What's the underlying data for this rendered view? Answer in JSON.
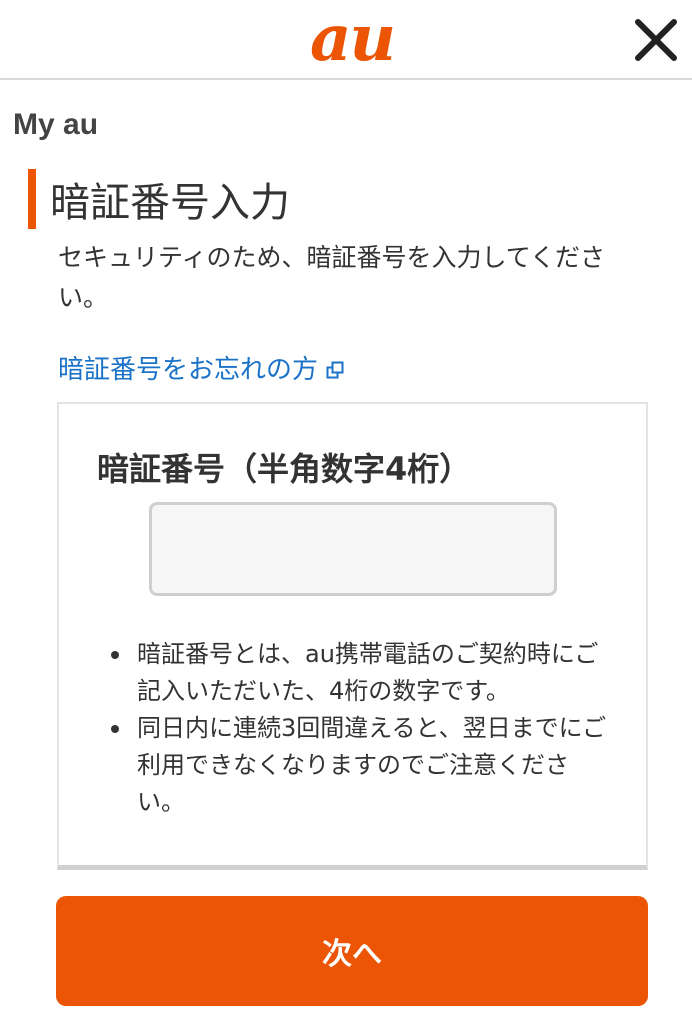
{
  "header": {
    "logo_text": "au",
    "close_icon": "close-icon"
  },
  "section_label": "My au",
  "page_title": "暗証番号入力",
  "description": "セキュリティのため、暗証番号を入力してください。",
  "forgot_link": {
    "label": "暗証番号をお忘れの方",
    "icon": "external-link-icon"
  },
  "card": {
    "title": "暗証番号（半角数字4桁）",
    "pin_input": {
      "value": "",
      "placeholder": ""
    },
    "notes": [
      "暗証番号とは、au携帯電話のご契約時にご記入いただいた、4桁の数字です。",
      "同日内に連続3回間違えると、翌日までにご利用できなくなりますのでご注意ください。"
    ]
  },
  "next_button": {
    "label": "次へ"
  },
  "colors": {
    "brand": "#eb5505",
    "link": "#1a73c8",
    "text": "#333333"
  }
}
